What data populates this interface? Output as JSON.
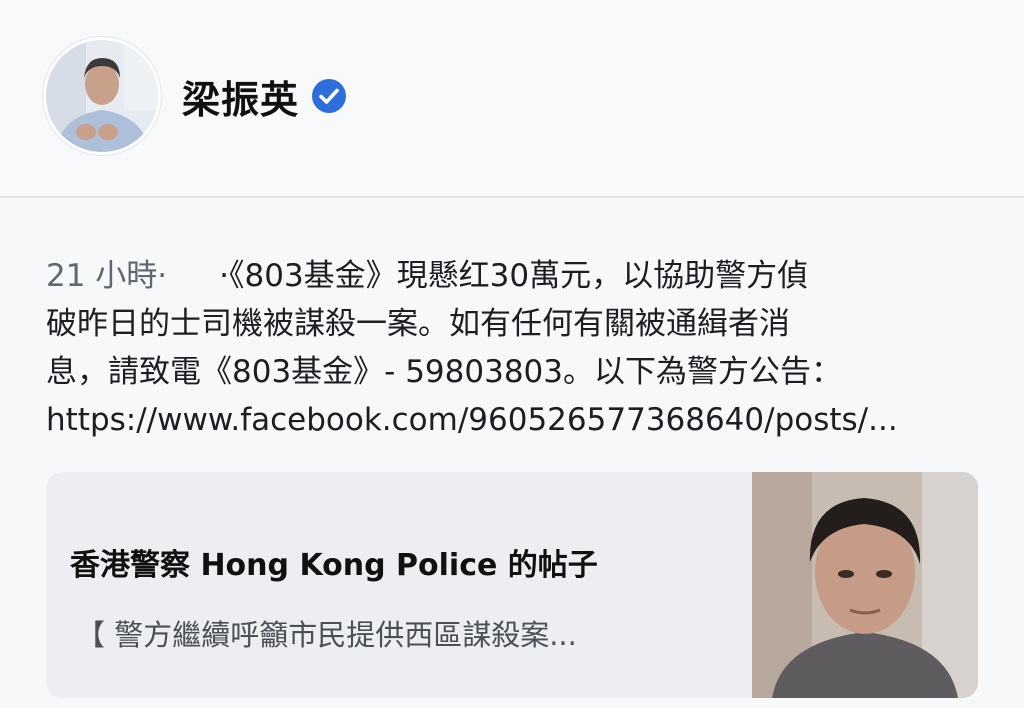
{
  "profile": {
    "name": "梁振英",
    "verified_icon": "verified-badge-icon",
    "accent": "#2d6edb"
  },
  "post": {
    "meta": "21 小時·",
    "lines": [
      "·《803基金》現懸红30萬元，以協助警方偵",
      "破昨日的士司機被謀殺一案。如有任何有關被通緝者消",
      "息，請致電《803基金》- 59803803。以下為警方公告：",
      "https://www.facebook.com/960526577368640/posts/..."
    ]
  },
  "link_card": {
    "title": "香港警察 Hong Kong Police 的帖子",
    "description": "【 警方繼續呼籲市民提供西區謀殺案..."
  }
}
